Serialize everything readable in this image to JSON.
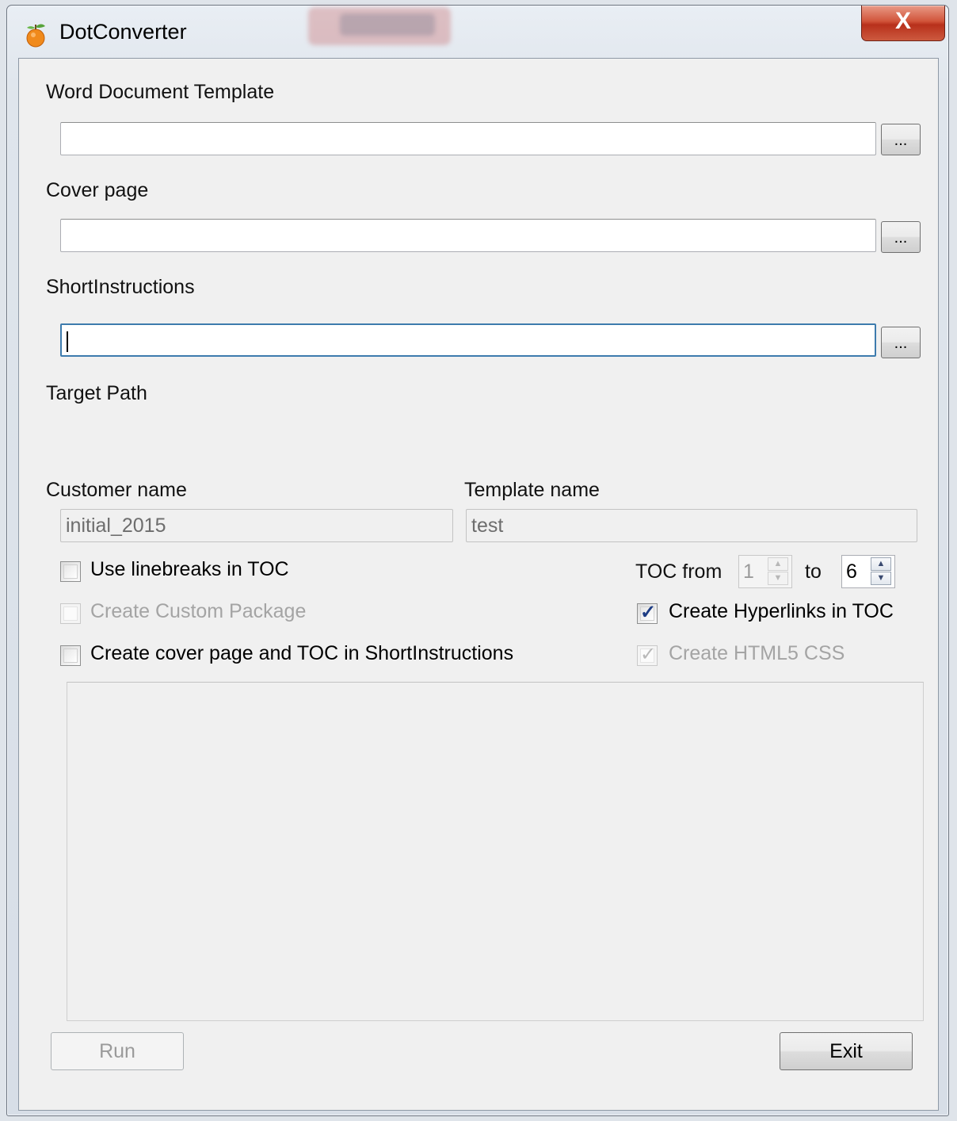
{
  "window": {
    "title": "DotConverter",
    "close_glyph": "X"
  },
  "fields": {
    "word_template": {
      "label": "Word Document Template",
      "value": "",
      "browse": "..."
    },
    "cover_page": {
      "label": "Cover page",
      "value": "",
      "browse": "..."
    },
    "short_instructions": {
      "label": "ShortInstructions",
      "value": "",
      "browse": "..."
    },
    "target_path": {
      "label": "Target Path"
    },
    "customer_name": {
      "label": "Customer name",
      "value": "initial_2015"
    },
    "template_name": {
      "label": "Template name",
      "value": "test"
    }
  },
  "options": {
    "use_linebreaks": {
      "label": "Use linebreaks in TOC",
      "checked": false,
      "enabled": true
    },
    "create_custom_package": {
      "label": "Create Custom Package",
      "checked": false,
      "enabled": false
    },
    "create_cover_toc": {
      "label": "Create cover page and TOC in ShortInstructions",
      "checked": false,
      "enabled": true
    },
    "create_hyperlinks": {
      "label": "Create Hyperlinks in TOC",
      "checked": true,
      "enabled": true
    },
    "create_html5_css": {
      "label": "Create HTML5 CSS",
      "checked": true,
      "enabled": false
    }
  },
  "toc": {
    "from_label": "TOC from",
    "from_value": "1",
    "to_label": "to",
    "to_value": "6"
  },
  "buttons": {
    "run": "Run",
    "exit": "Exit"
  },
  "icons": {
    "app": "orange-fruit-icon",
    "close": "close-icon",
    "check": "✓"
  },
  "colors": {
    "close_button": "#c8422a",
    "checkmark": "#1d3c84",
    "focus_border": "#3d7bad"
  }
}
